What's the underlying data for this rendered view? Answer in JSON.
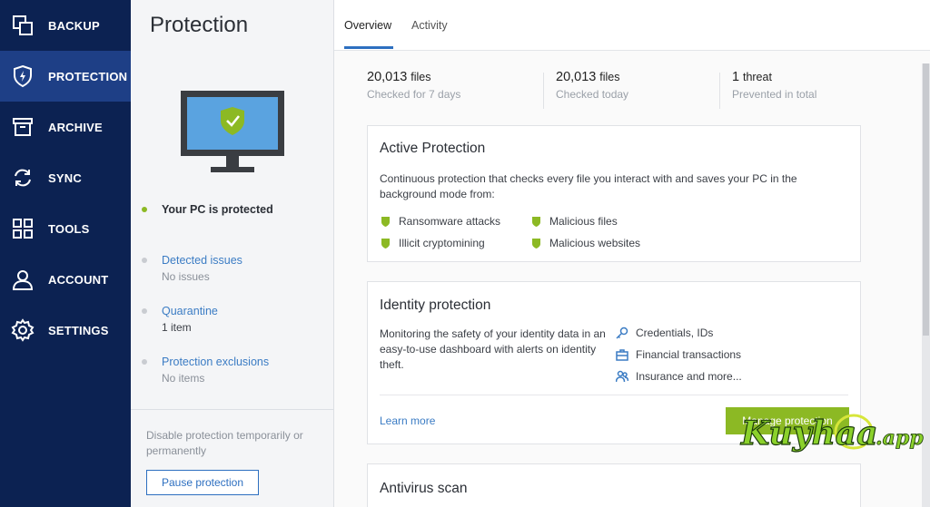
{
  "sidebar": {
    "items": [
      {
        "label": "BACKUP",
        "icon": "backup-copy-icon"
      },
      {
        "label": "PROTECTION",
        "icon": "shield-bolt-icon"
      },
      {
        "label": "ARCHIVE",
        "icon": "archive-box-icon"
      },
      {
        "label": "SYNC",
        "icon": "sync-arrows-icon"
      },
      {
        "label": "TOOLS",
        "icon": "grid-tools-icon"
      },
      {
        "label": "ACCOUNT",
        "icon": "user-icon"
      },
      {
        "label": "SETTINGS",
        "icon": "gear-icon"
      }
    ],
    "active_index": 1,
    "bg_color": "#0c2252",
    "active_color": "#1e3f86"
  },
  "panel": {
    "title": "Protection",
    "status": "Your PC is protected",
    "detected_issues": {
      "label": "Detected issues",
      "value": "No issues"
    },
    "quarantine": {
      "label": "Quarantine",
      "value": "1 item"
    },
    "exclusions": {
      "label": "Protection exclusions",
      "value": "No items"
    },
    "disable_text": "Disable protection temporarily or permanently",
    "pause_label": "Pause protection"
  },
  "tabs": [
    {
      "label": "Overview",
      "active": true
    },
    {
      "label": "Activity",
      "active": false
    }
  ],
  "stats": [
    {
      "number": "20,013",
      "unit": "files",
      "caption": "Checked for 7 days"
    },
    {
      "number": "20,013",
      "unit": "files",
      "caption": "Checked today"
    },
    {
      "number": "1",
      "unit": "threat",
      "caption": "Prevented in total"
    }
  ],
  "active_protection": {
    "title": "Active Protection",
    "description": "Continuous protection that checks every file you interact with and saves your PC in the background mode from:",
    "features": [
      "Ransomware attacks",
      "Malicious files",
      "Illicit cryptomining",
      "Malicious websites"
    ]
  },
  "identity_protection": {
    "title": "Identity protection",
    "description": "Monitoring the safety of your identity data in an easy-to-use dashboard with alerts on identity theft.",
    "features": [
      {
        "label": "Credentials, IDs",
        "icon": "key-icon"
      },
      {
        "label": "Financial transactions",
        "icon": "briefcase-icon"
      },
      {
        "label": "Insurance and more...",
        "icon": "people-icon"
      }
    ],
    "learn_more": "Learn more",
    "manage_label": "Manage protection"
  },
  "antivirus": {
    "title": "Antivirus scan"
  },
  "watermark": {
    "brand": "Kuyhaa",
    "suffix": ".app"
  },
  "colors": {
    "accent_green": "#8cb924",
    "link_blue": "#3b7cc4",
    "screen_blue": "#5aa3e0"
  }
}
